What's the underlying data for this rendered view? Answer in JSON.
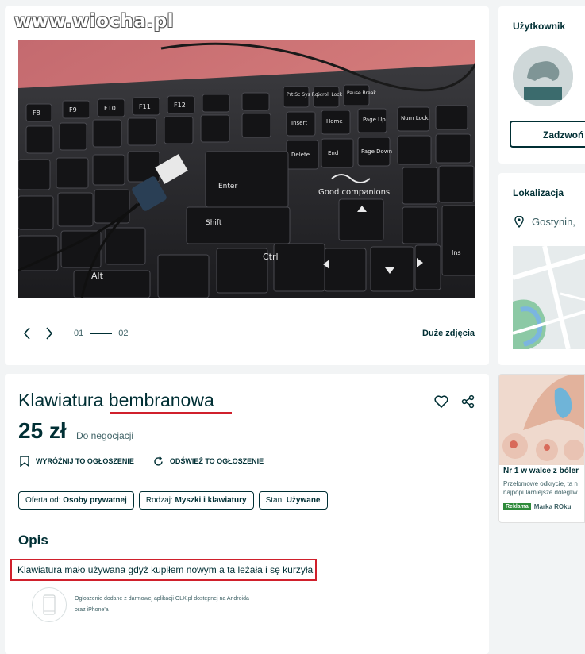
{
  "watermark": "www.wiocha.pl",
  "gallery": {
    "current_page": "01",
    "total_pages": "02",
    "big_photos_label": "Duże zdjęcia",
    "keyboard_text": {
      "enter": "Enter",
      "shift": "Shift",
      "ctrl": "Ctrl",
      "alt": "Alt",
      "brand": "Good companions",
      "insert": "Insert",
      "home": "Home",
      "page_up": "Page Up",
      "delete": "Delete",
      "end": "End",
      "page_down": "Page Down",
      "num_lock": "Num Lock",
      "prt_sc": "Prt Sc Sys Rq",
      "scroll_lock": "Scroll Lock",
      "pause_break": "Pause Break",
      "ins": "Ins",
      "f_keys": [
        "F8",
        "F9",
        "F10",
        "F11",
        "F12"
      ]
    }
  },
  "listing": {
    "title": "Klawiatura bembranowa",
    "price": "25 zł",
    "negotiation": "Do negocjacji",
    "actions": {
      "promote": "WYRÓŻNIJ TO OGŁOSZENIE",
      "refresh": "ODŚWIEŻ TO OGŁOSZENIE"
    },
    "params": [
      {
        "label": "Oferta od:",
        "value": "Osoby prywatnej"
      },
      {
        "label": "Rodzaj:",
        "value": "Myszki i klawiatury"
      },
      {
        "label": "Stan:",
        "value": "Używane"
      }
    ],
    "description_heading": "Opis",
    "description": "Klawiatura mało używana gdyż kupiłem nowym a ta leżała i sę kurzyła",
    "app_note": "Ogłoszenie dodane z darmowej aplikacji OLX.pl dostępnej na Androida oraz iPhone'a"
  },
  "sidebar": {
    "user_label": "Użytkownik",
    "call_label": "Zadzwoń",
    "location_label": "Lokalizacja",
    "city": "Gostynin,"
  },
  "ad": {
    "title": "Nr 1 w walce z bóler",
    "description_line1": "Przełomowe odkrycie, ta n",
    "description_line2": "najpopularniejsze dolegliw",
    "badge": "Reklama",
    "brand": "Marka ROku"
  },
  "colors": {
    "accent_red": "#d0202c",
    "text_dark": "#002f34",
    "text_muted": "#406367",
    "page_background": "#f2f4f5"
  }
}
